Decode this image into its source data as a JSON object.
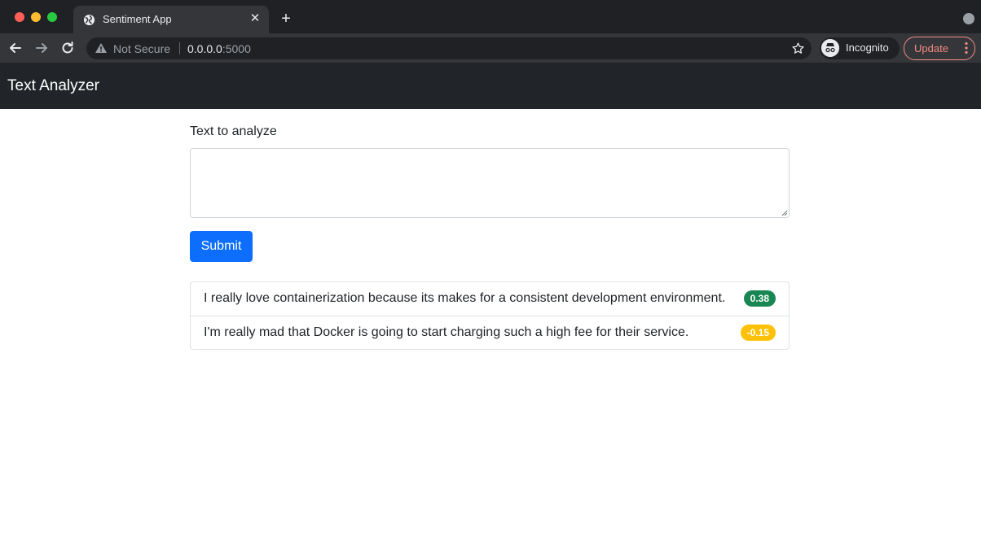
{
  "browser": {
    "tab_title": "Sentiment App",
    "tab_close": "✕",
    "new_tab": "+",
    "not_secure": "Not Secure",
    "url_host": "0.0.0.0",
    "url_port": ":5000",
    "incognito_label": "Incognito",
    "update_label": "Update",
    "icons": [
      "globe-icon",
      "back-arrow-icon",
      "forward-arrow-icon",
      "reload-icon",
      "warning-icon",
      "star-icon",
      "incognito-icon",
      "more-vert-icon",
      "tab-search-icon"
    ]
  },
  "navbar": {
    "brand": "Text Analyzer"
  },
  "form": {
    "label": "Text to analyze",
    "textarea_value": "",
    "submit_label": "Submit"
  },
  "results": [
    {
      "text": "I really love containerization because its makes for a consistent development environment.",
      "score": "0.38",
      "sentiment": "positive"
    },
    {
      "text": "I'm really mad that Docker is going to start charging such a high fee for their service.",
      "score": "-0.15",
      "sentiment": "negative"
    }
  ],
  "colors": {
    "navbar": "#212529",
    "primary": "#0d6efd",
    "positive_badge": "#198754",
    "negative_badge": "#ffc107"
  }
}
